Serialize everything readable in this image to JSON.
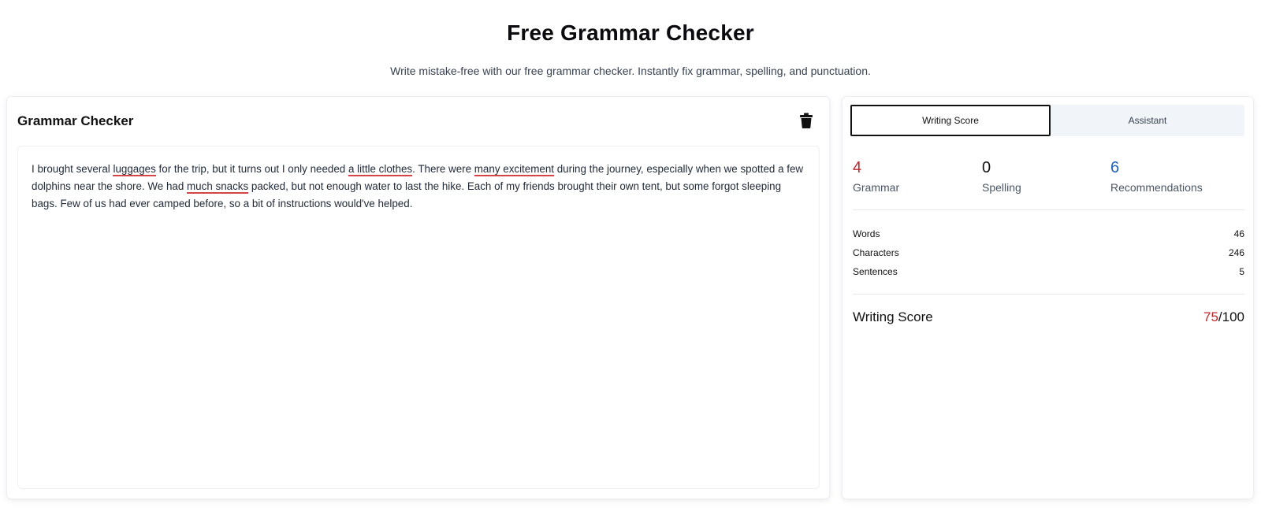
{
  "page": {
    "title": "Free Grammar Checker",
    "subtitle": "Write mistake-free with our free grammar checker. Instantly fix grammar, spelling, and punctuation."
  },
  "editor": {
    "title": "Grammar Checker",
    "delete_icon": "trash-icon",
    "segments": [
      {
        "text": "I brought several ",
        "error": false
      },
      {
        "text": "luggages",
        "error": true
      },
      {
        "text": " for the trip, but it turns out I only needed ",
        "error": false
      },
      {
        "text": "a little clothes",
        "error": true
      },
      {
        "text": ". There were ",
        "error": false
      },
      {
        "text": "many excitement",
        "error": true
      },
      {
        "text": " during the journey, especially when we spotted a few dolphins near the shore. We had ",
        "error": false
      },
      {
        "text": "much snacks",
        "error": true
      },
      {
        "text": " packed, but not enough water to last the hike. Each of my friends brought their own tent, but some forgot sleeping bags. Few of us had ever camped before, so a bit of instructions would've helped.",
        "error": false
      }
    ]
  },
  "side_panel": {
    "tabs": [
      {
        "label": "Writing Score",
        "active": true
      },
      {
        "label": "Assistant",
        "active": false
      }
    ],
    "stats": [
      {
        "value": "4",
        "label": "Grammar",
        "color": "#c0262d"
      },
      {
        "value": "0",
        "label": "Spelling",
        "color": "#111111"
      },
      {
        "value": "6",
        "label": "Recommendations",
        "color": "#1d5fbf"
      }
    ],
    "counts": [
      {
        "label": "Words",
        "value": "46"
      },
      {
        "label": "Characters",
        "value": "246"
      },
      {
        "label": "Sentences",
        "value": "5"
      }
    ],
    "score": {
      "label": "Writing Score",
      "value": "75",
      "max": "/100",
      "value_color": "#c0262d"
    }
  },
  "colors": {
    "error_underline": "#d64545",
    "accent_red": "#c0262d",
    "accent_blue": "#1d5fbf"
  }
}
